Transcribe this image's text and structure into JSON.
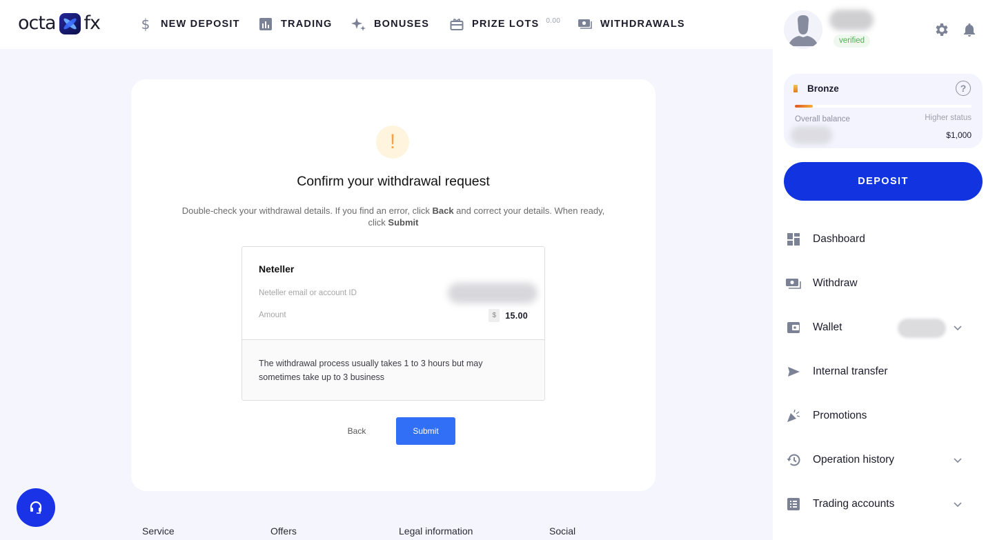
{
  "brand": {
    "left": "octa",
    "right": "fx"
  },
  "nav": [
    {
      "label": "NEW DEPOSIT",
      "icon": "dollar-icon"
    },
    {
      "label": "TRADING",
      "icon": "chart-icon"
    },
    {
      "label": "BONUSES",
      "icon": "sparkle-icon"
    },
    {
      "label": "PRIZE LOTS",
      "icon": "gift-icon",
      "badge": "0.00"
    },
    {
      "label": "WITHDRAWALS",
      "icon": "cash-icon"
    }
  ],
  "dialog": {
    "icon": "!",
    "title": "Confirm your withdrawal request",
    "desc_1": "Double-check your withdrawal details. If you find an error, click ",
    "desc_back": "Back",
    "desc_2": " and correct your details. When ready, click ",
    "desc_submit": "Submit",
    "method": "Neteller",
    "account_label": "Neteller email or account ID",
    "amount_label": "Amount",
    "currency_symbol": "$",
    "amount_value": "15.00",
    "note": "The withdrawal process usually takes 1 to 3 hours but may sometimes take up to 3 business",
    "back_label": "Back",
    "submit_label": "Submit"
  },
  "footer": {
    "columns": [
      "Service",
      "Offers",
      "Legal information",
      "Social"
    ]
  },
  "profile": {
    "verified_label": "verified"
  },
  "status": {
    "tier": "Bronze",
    "help": "?",
    "progress_percent": 10,
    "overall_balance_label": "Overall balance",
    "higher_status_label": "Higher status",
    "higher_status_value": "$1,000"
  },
  "deposit_label": "DEPOSIT",
  "menu": [
    {
      "label": "Dashboard",
      "icon": "dashboard-icon",
      "expandable": false
    },
    {
      "label": "Withdraw",
      "icon": "withdraw-icon",
      "expandable": false
    },
    {
      "label": "Wallet",
      "icon": "wallet-icon",
      "expandable": true
    },
    {
      "label": "Internal transfer",
      "icon": "send-icon",
      "expandable": false
    },
    {
      "label": "Promotions",
      "icon": "party-popper-icon",
      "expandable": false
    },
    {
      "label": "Operation history",
      "icon": "history-icon",
      "expandable": true
    },
    {
      "label": "Trading accounts",
      "icon": "list-icon",
      "expandable": true
    }
  ],
  "colors": {
    "brand_blue": "#1233e0",
    "submit_blue": "#316ff6",
    "verified_green": "#4caf50",
    "warning_orange": "#f0a54a",
    "page_bg": "#f4f5fd"
  }
}
